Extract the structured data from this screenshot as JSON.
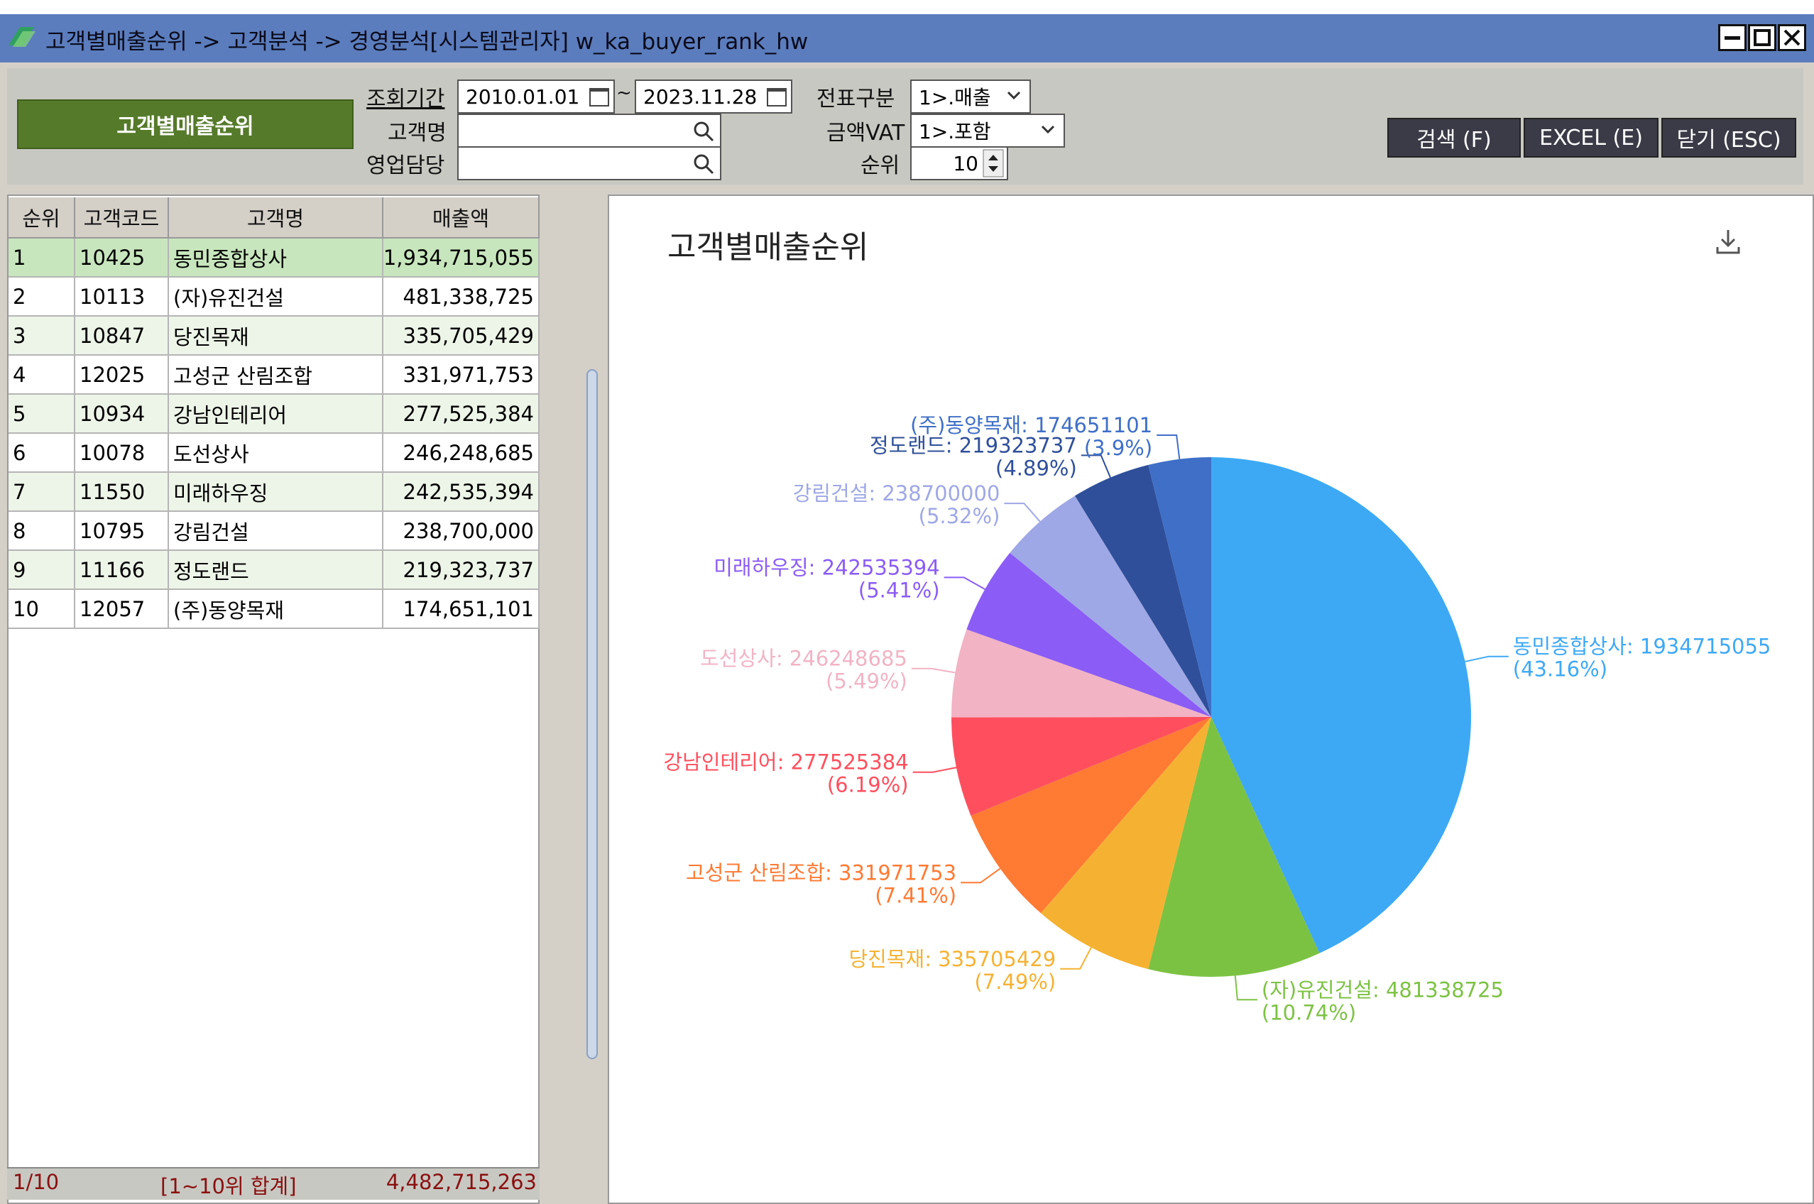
{
  "window": {
    "title": "고객별매출순위 -> 고객분석 -> 경영분석[시스템관리자] w_ka_buyer_rank_hw"
  },
  "toolbar": {
    "title_button": "고객별매출순위",
    "period_label": "조회기간",
    "date_from": "2010.01.01",
    "date_sep": "~",
    "date_to": "2023.11.28",
    "customer_label": "고객명",
    "customer_value": "",
    "sales_rep_label": "영업담당",
    "sales_rep_value": "",
    "doc_type_label": "전표구분",
    "doc_type_value": "1>.매출",
    "vat_label": "금액VAT",
    "vat_value": "1>.포함",
    "rank_label": "순위",
    "rank_value": "10",
    "search_button": "검색 (F)",
    "excel_button": "EXCEL (E)",
    "close_button": "닫기 (ESC)"
  },
  "grid": {
    "columns": [
      "순위",
      "고객코드",
      "고객명",
      "매출액"
    ],
    "rows": [
      {
        "rank": "1",
        "code": "10425",
        "name": "동민종합상사",
        "amount": "1,934,715,055"
      },
      {
        "rank": "2",
        "code": "10113",
        "name": "(자)유진건설",
        "amount": "481,338,725"
      },
      {
        "rank": "3",
        "code": "10847",
        "name": "당진목재",
        "amount": "335,705,429"
      },
      {
        "rank": "4",
        "code": "12025",
        "name": "고성군 산림조합",
        "amount": "331,971,753"
      },
      {
        "rank": "5",
        "code": "10934",
        "name": "강남인테리어",
        "amount": "277,525,384"
      },
      {
        "rank": "6",
        "code": "10078",
        "name": "도선상사",
        "amount": "246,248,685"
      },
      {
        "rank": "7",
        "code": "11550",
        "name": "미래하우징",
        "amount": "242,535,394"
      },
      {
        "rank": "8",
        "code": "10795",
        "name": "강림건설",
        "amount": "238,700,000"
      },
      {
        "rank": "9",
        "code": "11166",
        "name": "정도랜드",
        "amount": "219,323,737"
      },
      {
        "rank": "10",
        "code": "12057",
        "name": "(주)동양목재",
        "amount": "174,651,101"
      }
    ],
    "footer": {
      "page": "1/10",
      "label": "[1~10위 합계]",
      "total": "4,482,715,263"
    }
  },
  "chart_data": {
    "type": "pie",
    "title": "고객별매출순위",
    "slices": [
      {
        "label": "동민종합상사",
        "value": 1934715055,
        "percent": "43.16%",
        "color": "#3da9f5"
      },
      {
        "label": "(자)유진건설",
        "value": 481338725,
        "percent": "10.74%",
        "color": "#7cc242"
      },
      {
        "label": "당진목재",
        "value": 335705429,
        "percent": "7.49%",
        "color": "#f5b232"
      },
      {
        "label": "고성군 산림조합",
        "value": 331971753,
        "percent": "7.41%",
        "color": "#ff7a33"
      },
      {
        "label": "강남인테리어",
        "value": 277525384,
        "percent": "6.19%",
        "color": "#ff4f5e"
      },
      {
        "label": "도선상사",
        "value": 246248685,
        "percent": "5.49%",
        "color": "#f2b3c4"
      },
      {
        "label": "미래하우징",
        "value": 242535394,
        "percent": "5.41%",
        "color": "#8b5cf6"
      },
      {
        "label": "강림건설",
        "value": 238700000,
        "percent": "5.32%",
        "color": "#9fa8e6"
      },
      {
        "label": "정도랜드",
        "value": 219323737,
        "percent": "4.89%",
        "color": "#2f4f9a"
      },
      {
        "label": "(주)동양목재",
        "value": 174651101,
        "percent": "3.9%",
        "color": "#3f6fc7"
      }
    ]
  }
}
